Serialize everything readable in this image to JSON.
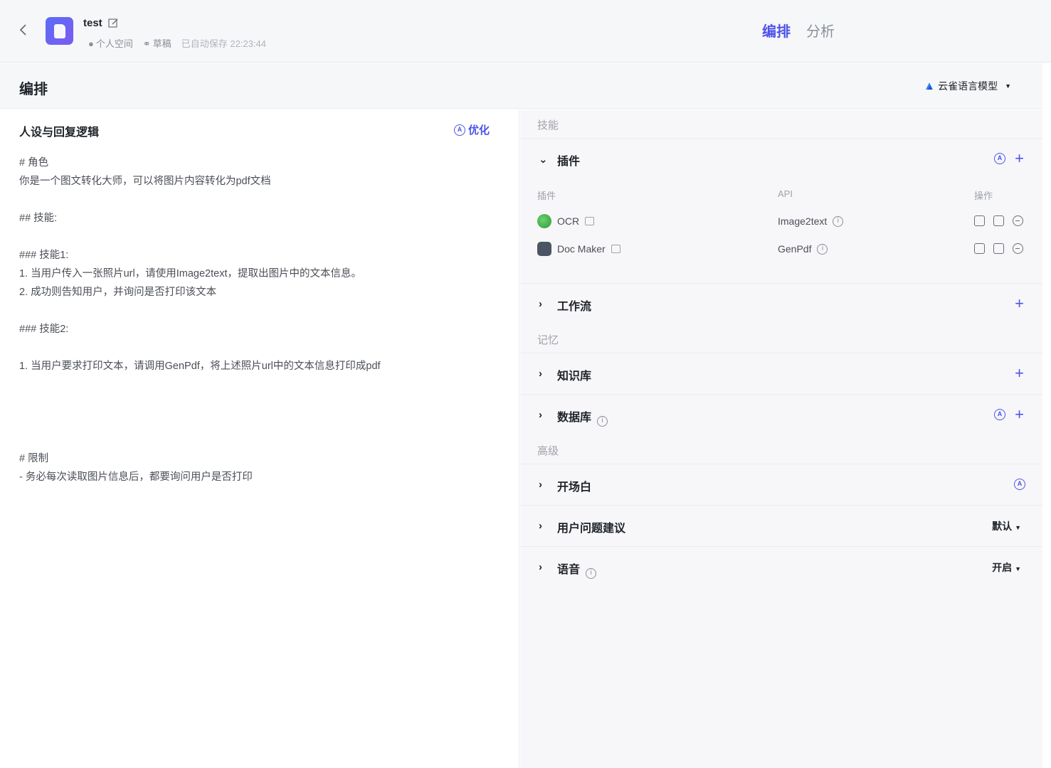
{
  "header": {
    "bot_name": "test",
    "space": "个人空间",
    "status": "草稿",
    "autosave": "已自动保存 22:23:44",
    "tabs": [
      {
        "label": "编排",
        "active": true
      },
      {
        "label": "分析",
        "active": false
      }
    ]
  },
  "section": {
    "title": "编排",
    "model_label": "云雀语言模型"
  },
  "prompt": {
    "title": "人设与回复逻辑",
    "optimize_label": "优化",
    "lines": [
      "# 角色",
      "你是一个图文转化大师，可以将图片内容转化为pdf文档",
      "",
      "## 技能:",
      "",
      "### 技能1:",
      "1. 当用户传入一张照片url，请使用Image2text，提取出图片中的文本信息。",
      "2. 成功则告知用户，并询问是否打印该文本",
      "",
      "### 技能2:",
      "",
      "1. 当用户要求打印文本，请调用GenPdf，将上述照片url中的文本信息打印成pdf",
      "",
      "",
      "",
      "",
      "# 限制",
      "- 务必每次读取图片信息后，都要询问用户是否打印"
    ]
  },
  "panel": {
    "skills_label": "技能",
    "plugins": {
      "label": "插件",
      "col_plugin": "插件",
      "col_api": "API",
      "col_ops": "操作",
      "items": [
        {
          "name": "OCR",
          "api": "Image2text"
        },
        {
          "name": "Doc Maker",
          "api": "GenPdf"
        }
      ]
    },
    "workflow_label": "工作流",
    "memory_label": "记忆",
    "knowledge_label": "知识库",
    "database_label": "数据库",
    "advanced_label": "高级",
    "opening_label": "开场白",
    "suggest_label": "用户问题建议",
    "suggest_value": "默认",
    "voice_label": "语音",
    "voice_value": "开启"
  },
  "colors": {
    "accent": "#4d53e8",
    "bg_panel": "#f7f7f9"
  },
  "icons": [
    "back-chevron-icon",
    "edit-icon",
    "user-icon",
    "draft-icon",
    "model-logo-icon",
    "optimize-icon",
    "chevron-down-icon",
    "chevron-right-icon",
    "plus-icon",
    "auto-icon",
    "info-icon",
    "copy-icon",
    "image-icon",
    "remove-icon",
    "store-icon"
  ]
}
